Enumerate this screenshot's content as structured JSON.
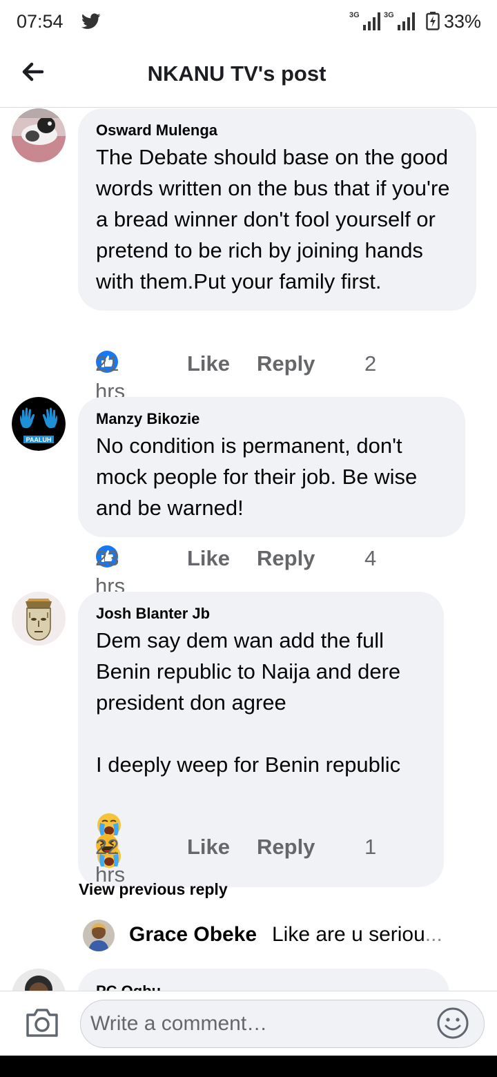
{
  "status_bar": {
    "time": "07:54",
    "network1": "3G",
    "network2": "3G",
    "battery": "33%",
    "icons": [
      "twitter-icon",
      "signal-icon",
      "signal-icon",
      "battery-charging-icon"
    ]
  },
  "header": {
    "title": "NKANU TV's post",
    "back_icon": "arrow-left-icon"
  },
  "comments": [
    {
      "author": "Osward Mulenga",
      "text": "The Debate  should base on the good words written on the bus that if you're a bread winner don't fool yourself or pretend to be rich by joining hands with them.Put your family first.",
      "time": "21 hrs",
      "like_label": "Like",
      "reply_label": "Reply",
      "reaction": "like",
      "reaction_count": "2"
    },
    {
      "author": "Manzy Bikozie",
      "avatar_text": "PAALUH",
      "text": "No condition is permanent, don't mock people for their job. Be wise and be warned!",
      "time": "23 hrs",
      "like_label": "Like",
      "reply_label": "Reply",
      "reaction": "like",
      "reaction_count": "4"
    },
    {
      "author": "Josh Blanter Jb",
      "text": "Dem say dem wan add the full Benin republic to Naija and dere president don agree\n\nI deeply weep for Benin republic",
      "text_emojis": [
        "loudly-crying-face",
        "loudly-crying-face"
      ],
      "time": "22 hrs",
      "like_label": "Like",
      "reply_label": "Reply",
      "reaction": "haha",
      "reaction_count": "1"
    }
  ],
  "view_previous": "View previous reply",
  "reply_preview": {
    "author": "Grace Obeke",
    "text": "Like are u seriou",
    "ellipsis": "..."
  },
  "partial_comment": {
    "author": "PC Ogbu"
  },
  "composer": {
    "placeholder": "Write a comment…",
    "camera_icon": "camera-icon",
    "emoji_icon": "smiley-icon"
  },
  "colors": {
    "bubble": "#f0f2f5",
    "meta_text": "#65676b",
    "like_blue": "#1877f2",
    "haha_yellow": "#f7b928"
  }
}
